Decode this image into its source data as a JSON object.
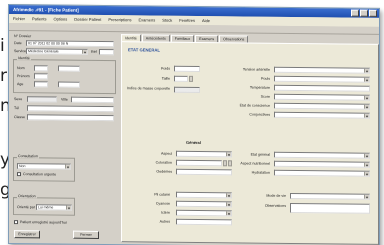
{
  "left_letters": [
    "i",
    "r",
    "n",
    "y",
    "g"
  ],
  "window": {
    "title": "Afrimedic .#91 - [Fiche Patient]"
  },
  "menu": [
    "Fichier",
    "Patients",
    "Options",
    "Dossier Patient",
    "Prescriptions",
    "Examens",
    "Stock",
    "Fenêtres",
    "Aide"
  ],
  "left": {
    "header": "N° Dossier",
    "date_label": "Date",
    "date_value": "01 07 2011 02 00 00 08 N",
    "service_label": "Service",
    "service_value": "Médecine Générale",
    "ref_label": "Réf",
    "group_identity": "Identité",
    "nom_label": "Nom",
    "prenom_label": "Prénom",
    "age_label": "Age",
    "sexe_label": "Sexe",
    "ville_label": "Ville",
    "tel_label": "Tél",
    "classe_label": "Classe",
    "group_consultation": "Consultation",
    "consult_value": "Non",
    "chk_label": "Consultation urgente",
    "group_orientation": "Orientation",
    "orient_label": "Orienté par",
    "orient_value": "Lui même",
    "chk2_label": "Patient enregistré aujourd'hui",
    "btn_ok": "Enregistrer",
    "btn_cancel": "Fermer"
  },
  "tabs": [
    "Identité",
    "Antécédents",
    "Familiaux",
    "Examens",
    "Observations"
  ],
  "main": {
    "section_title": "ETAT GENERAL",
    "poids_label": "Poids",
    "taille_label": "Taille",
    "imc_label": "Indice de masse corporelle",
    "tension_label": "Tension artérielle",
    "pouls_label": "Pouls",
    "temp_label": "Température",
    "score_label": "Score",
    "etat_label": "Etat de conscience",
    "conj_label": "Conjonctives",
    "sub_title": "Général",
    "col1": [
      "Aspect",
      "Coloration",
      "Oedèmes"
    ],
    "col2": [
      "Etat général",
      "Aspect nutritionnel",
      "Hydratation"
    ],
    "col3": [
      "Pli cutané",
      "Cyanose",
      "Ictère",
      "Autres"
    ],
    "col4": [
      "Mode de vie",
      "Observations"
    ]
  }
}
